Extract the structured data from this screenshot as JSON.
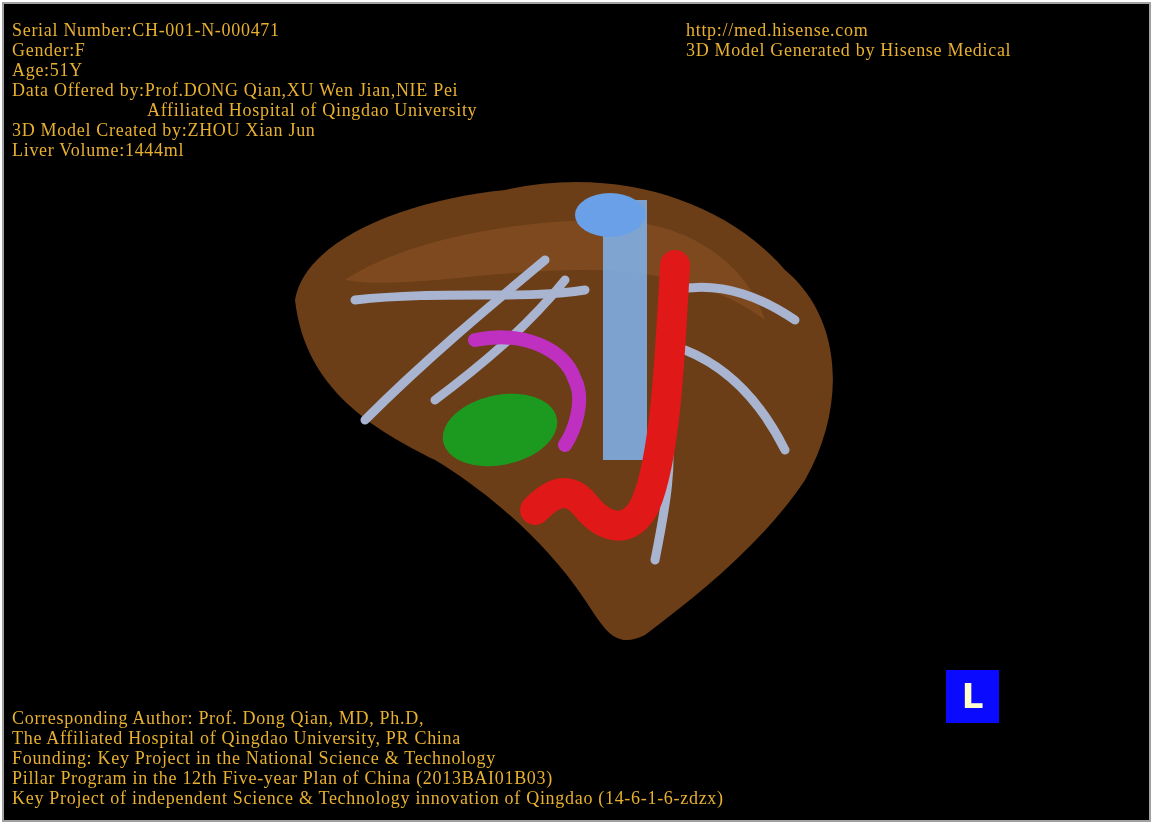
{
  "top_left_info": [
    {
      "text": "Serial Number:CH-001-N-000471",
      "kind": "line"
    },
    {
      "text": "Gender:F",
      "kind": "line"
    },
    {
      "text": "Age:51Y",
      "kind": "line"
    },
    {
      "text": "Data Offered by:Prof.DONG Qian,XU Wen Jian,NIE Pei",
      "kind": "line"
    },
    {
      "text": "Affiliated Hospital of Qingdao University",
      "kind": "continuation"
    },
    {
      "text": "3D Model Created by:ZHOU Xian Jun",
      "kind": "line"
    },
    {
      "text": "Liver Volume:1444ml",
      "kind": "line"
    }
  ],
  "top_right_info": [
    "http://med.hisense.com",
    "3D Model Generated by Hisense Medical"
  ],
  "bottom_info": [
    "Corresponding Author: Prof. Dong Qian, MD, Ph.D,",
    "The Affiliated Hospital of Qingdao University, PR China",
    "Founding: Key Project in the National Science & Technology",
    "Pillar Program in the 12th Five-year Plan of China (2013BAI01B03)",
    "Key Project of independent Science & Technology innovation of Qingdao (14-6-1-6-zdzx)"
  ],
  "orientation_badge": {
    "label": "L"
  }
}
